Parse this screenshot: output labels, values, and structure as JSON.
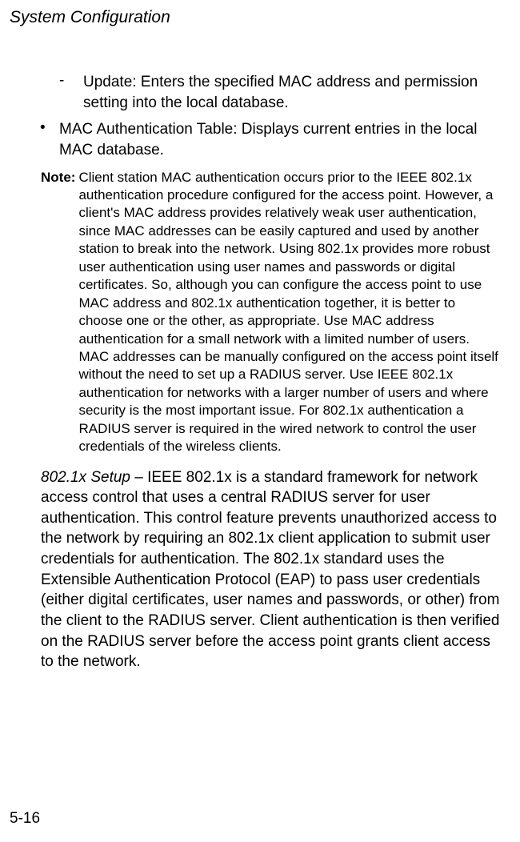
{
  "header": "System Configuration",
  "dash": {
    "bullet": "-",
    "text": "Update: Enters the specified MAC address and permission setting into the local database."
  },
  "bullet": {
    "mark": "•",
    "text": "MAC Authentication Table: Displays current entries in the local MAC database."
  },
  "note": {
    "label": "Note:",
    "text": "Client station MAC authentication occurs prior to the IEEE 802.1x authentication procedure configured for the access point. However, a client's MAC address provides relatively weak user authentication, since MAC addresses can be easily captured and used by another station to break into the network. Using 802.1x provides more robust user authentication using user names and passwords or digital certificates. So, although you can configure the access point to use MAC address and 802.1x authentication together, it is better to choose one or the other, as appropriate. Use MAC address authentication for a small network with a limited number of users. MAC addresses can be manually configured on the access point itself without the need to set up a RADIUS server. Use IEEE 802.1x authentication for networks with a larger number of users and where security is the most important issue. For 802.1x authentication a RADIUS server is required in the wired network to control the user credentials of the wireless clients."
  },
  "paragraph": {
    "lead": "802.1x Setup",
    "rest": " – IEEE 802.1x is a standard framework for network access control that uses a central RADIUS server for user authentication. This control feature prevents unauthorized access to the network by requiring an 802.1x client application to submit user credentials for authentication. The 802.1x standard uses the Extensible Authentication Protocol (EAP) to pass user credentials (either digital certificates, user names and passwords, or other) from the client to the RADIUS server. Client authentication is then verified on the RADIUS server before the access point grants client access to the network."
  },
  "pageNumber": "5-16"
}
